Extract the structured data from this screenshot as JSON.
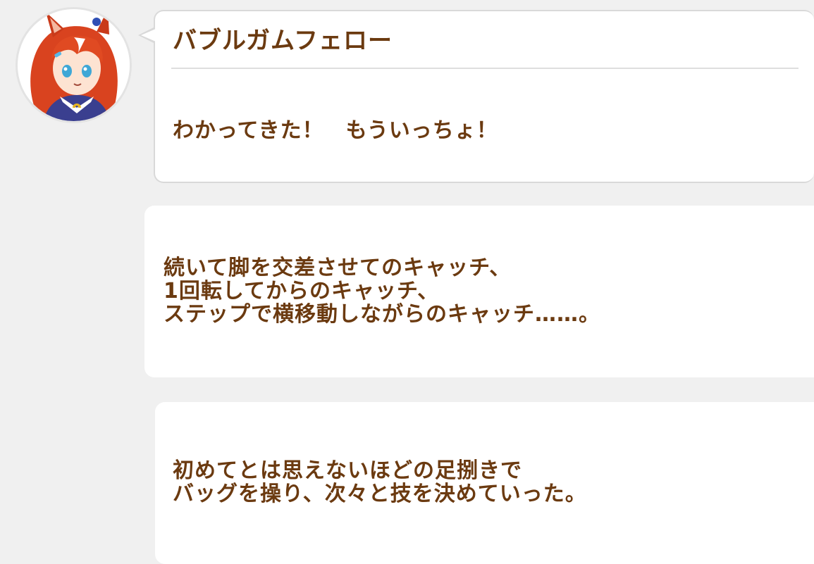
{
  "dialogue": {
    "speaker": "バブルガムフェロー",
    "text": "わかってきた！　もういっちょ！"
  },
  "narration": [
    {
      "lines": [
        "続いて脚を交差させてのキャッチ、",
        "1回転してからのキャッチ、",
        "ステップで横移動しながらのキャッチ……。"
      ]
    },
    {
      "lines": [
        "初めてとは思えないほどの足捌きで",
        "バッグを操り、次々と技を決めていった。"
      ]
    }
  ],
  "colors": {
    "text": "#6b3a10",
    "background": "#f0f0f0",
    "bubble": "#ffffff",
    "hair": "#d9431f"
  },
  "icons": {
    "avatar": "character-portrait"
  }
}
